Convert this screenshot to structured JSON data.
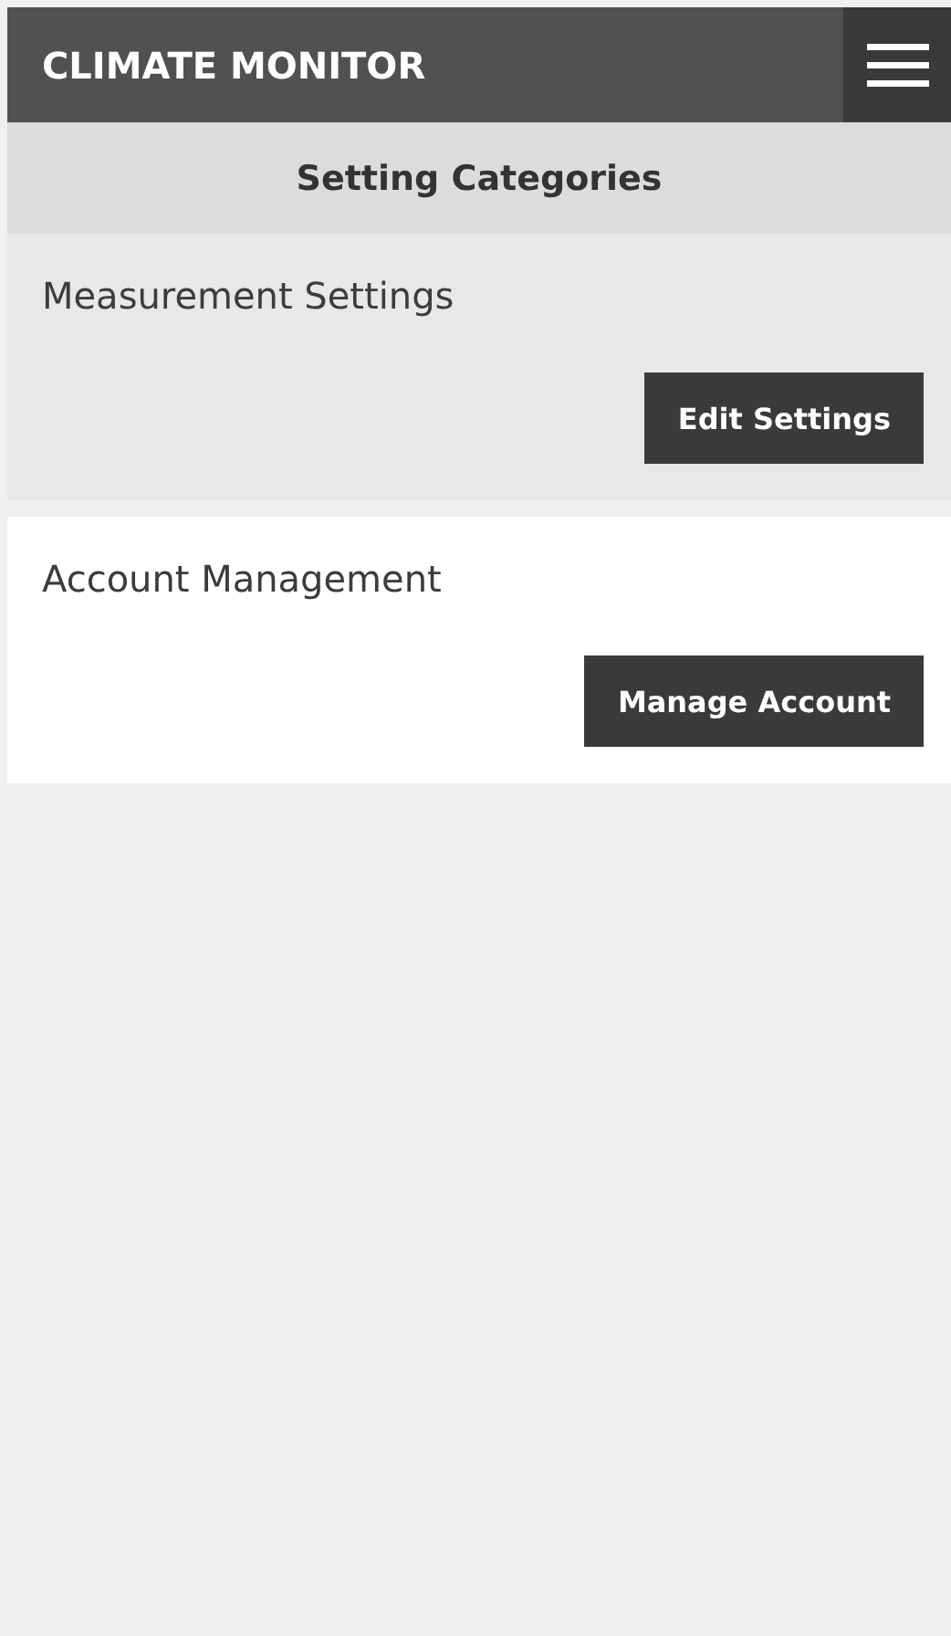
{
  "header": {
    "title": "CLIMATE MONITOR"
  },
  "section": {
    "title": "Setting Categories"
  },
  "categories": [
    {
      "title": "Measurement Settings",
      "button": "Edit Settings",
      "highlighted": true
    },
    {
      "title": "Account Management",
      "button": "Manage Account",
      "highlighted": false
    }
  ]
}
